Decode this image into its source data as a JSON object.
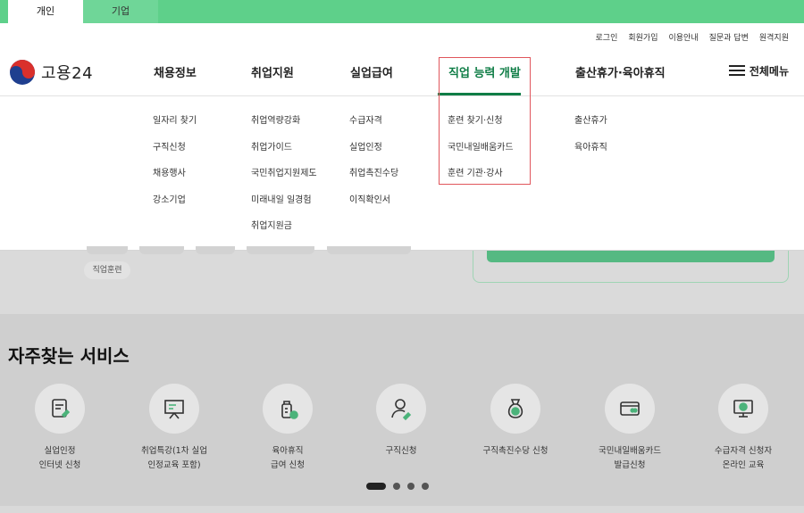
{
  "top_tabs": [
    "개인",
    "기업"
  ],
  "utility_links": [
    "로그인",
    "회원가입",
    "이용안내",
    "질문과 답변",
    "원격지원"
  ],
  "logo": {
    "text": "고용24"
  },
  "gnb": [
    {
      "label": "채용정보",
      "items": [
        "일자리 찾기",
        "구직신청",
        "채용행사",
        "강소기업"
      ]
    },
    {
      "label": "취업지원",
      "items": [
        "취업역량강화",
        "취업가이드",
        "국민취업지원제도",
        "미래내일 일경험",
        "취업지원금"
      ]
    },
    {
      "label": "실업급여",
      "items": [
        "수급자격",
        "실업인정",
        "취업촉진수당",
        "이직확인서"
      ]
    },
    {
      "label": "직업 능력 개발",
      "items": [
        "훈련 찾기·신청",
        "국민내일배움카드",
        "훈련 기관·강사"
      ]
    },
    {
      "label": "출산휴가·육아휴직",
      "items": [
        "출산휴가",
        "육아휴직"
      ]
    }
  ],
  "all_menu_label": "전체메뉴",
  "background": {
    "tag": "직업훈련"
  },
  "services": {
    "title": "자주찾는 서비스",
    "items": [
      {
        "line1": "실업인정",
        "line2": "인터넷 신청",
        "icon": "document-pen-icon"
      },
      {
        "line1": "취업특강(1차 실업",
        "line2": "인정교육 포함)",
        "icon": "presentation-board-icon"
      },
      {
        "line1": "육아휴직",
        "line2": "급여 신청",
        "icon": "baby-bottle-icon"
      },
      {
        "line1": "구직신청",
        "line2": "",
        "icon": "person-pen-icon"
      },
      {
        "line1": "구직촉진수당 신청",
        "line2": "",
        "icon": "money-bag-icon"
      },
      {
        "line1": "국민내일배움카드",
        "line2": "발급신청",
        "icon": "credit-card-icon"
      },
      {
        "line1": "수급자격 신청자",
        "line2": "온라인 교육",
        "icon": "monitor-play-icon"
      }
    ]
  },
  "colors": {
    "brand_green": "#5ed08a",
    "active_underline": "#0f7d46",
    "highlight_box": "#e0565c"
  }
}
